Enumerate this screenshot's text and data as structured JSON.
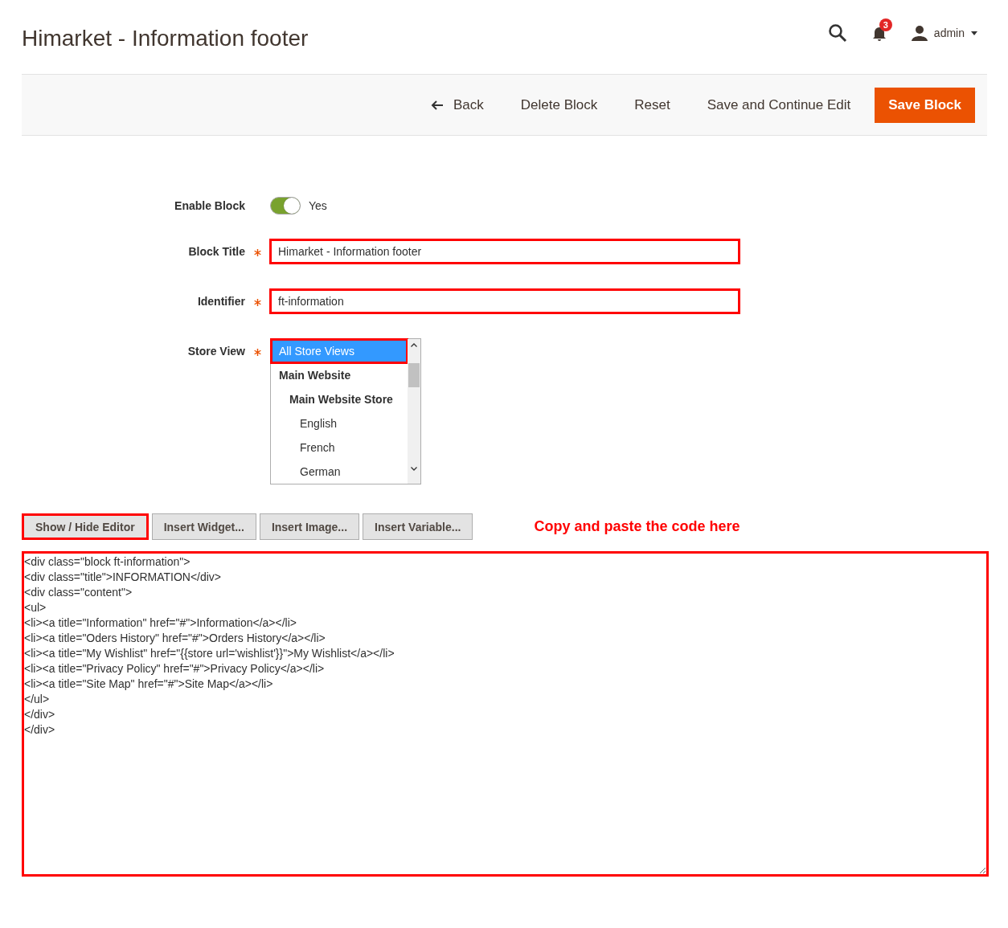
{
  "page_title": "Himarket - Information footer",
  "header": {
    "notification_count": "3",
    "user": "admin"
  },
  "actions": [
    {
      "label": "Back",
      "kind": "back"
    },
    {
      "label": "Delete Block",
      "kind": "plain"
    },
    {
      "label": "Reset",
      "kind": "plain"
    },
    {
      "label": "Save and Continue Edit",
      "kind": "plain"
    },
    {
      "label": "Save Block",
      "kind": "primary"
    }
  ],
  "form": {
    "enable": {
      "label": "Enable Block",
      "on": true,
      "value": "Yes"
    },
    "fields": [
      {
        "label": "Block Title",
        "required": true,
        "value": "Himarket - Information footer",
        "highlighted": true
      },
      {
        "label": "Identifier",
        "required": true,
        "value": "ft-information",
        "highlighted": true
      }
    ],
    "store_view": {
      "label": "Store View",
      "required": true,
      "options": [
        {
          "label": "All Store Views",
          "selected": true,
          "highlighted": true
        },
        {
          "label": "Main Website",
          "selected": false,
          "highlighted": false,
          "children": [
            {
              "label": "Main Website Store",
              "selected": false,
              "highlighted": false,
              "children": [
                {
                  "label": "English",
                  "selected": false,
                  "highlighted": false
                },
                {
                  "label": "French",
                  "selected": false,
                  "highlighted": false
                },
                {
                  "label": "German",
                  "selected": false,
                  "highlighted": false
                }
              ]
            }
          ]
        }
      ]
    }
  },
  "editor_buttons": [
    {
      "label": "Show / Hide Editor",
      "highlighted": true
    },
    {
      "label": "Insert Widget...",
      "highlighted": false
    },
    {
      "label": "Insert Image...",
      "highlighted": false
    },
    {
      "label": "Insert Variable...",
      "highlighted": false
    }
  ],
  "annotation": "Copy and paste the code here",
  "editor": {
    "highlighted": true,
    "value": "<div class=\"block ft-information\">\n<div class=\"title\">INFORMATION</div>\n<div class=\"content\">\n<ul>\n<li><a title=\"Information\" href=\"#\">Information</a></li>\n<li><a title=\"Oders History\" href=\"#\">Orders History</a></li>\n<li><a title=\"My Wishlist\" href=\"{{store url='wishlist'}}\">My Wishlist</a></li>\n<li><a title=\"Privacy Policy\" href=\"#\">Privacy Policy</a></li>\n<li><a title=\"Site Map\" href=\"#\">Site Map</a></li>\n</ul>\n</div>\n</div>"
  }
}
